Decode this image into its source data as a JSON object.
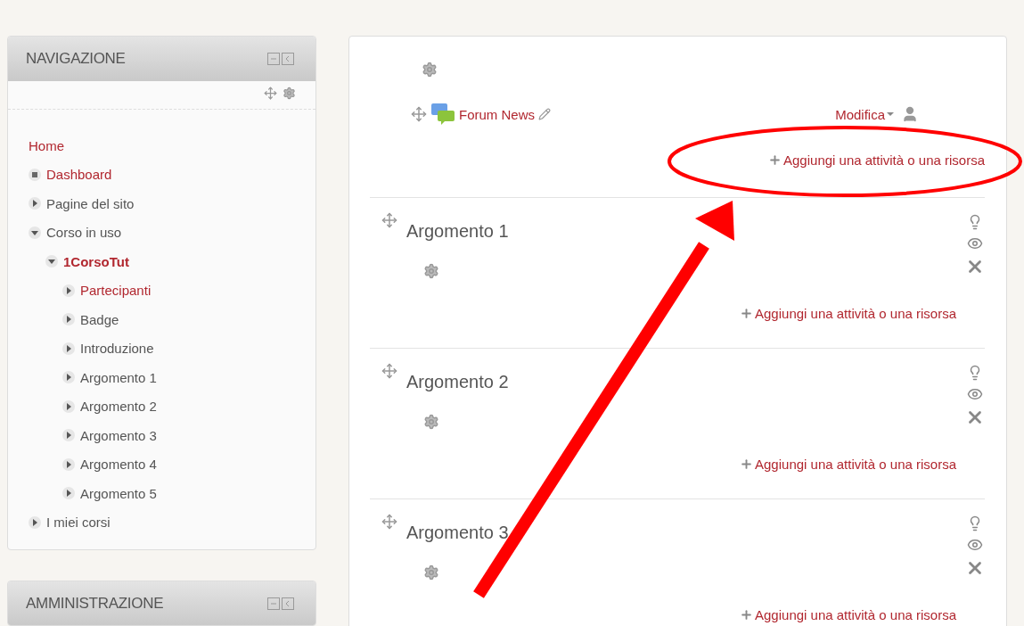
{
  "navigation": {
    "title": "NAVIGAZIONE",
    "items": [
      {
        "label": "Home",
        "kind": "plain",
        "link": true,
        "current": false
      },
      {
        "label": "Dashboard",
        "kind": "leaf",
        "link": true,
        "current": false
      },
      {
        "label": "Pagine del sito",
        "kind": "branch",
        "expanded": false,
        "link": false,
        "current": false
      },
      {
        "label": "Corso in uso",
        "kind": "branch",
        "expanded": true,
        "link": false,
        "current": false,
        "children": [
          {
            "label": "1CorsoTut",
            "kind": "branch",
            "expanded": true,
            "link": true,
            "current": true,
            "children": [
              {
                "label": "Partecipanti",
                "kind": "branch",
                "expanded": false,
                "link": true,
                "current": false
              },
              {
                "label": "Badge",
                "kind": "branch",
                "expanded": false,
                "link": false,
                "current": false
              },
              {
                "label": "Introduzione",
                "kind": "branch",
                "expanded": false,
                "link": false,
                "current": false
              },
              {
                "label": "Argomento 1",
                "kind": "branch",
                "expanded": false,
                "link": false,
                "current": false
              },
              {
                "label": "Argomento 2",
                "kind": "branch",
                "expanded": false,
                "link": false,
                "current": false
              },
              {
                "label": "Argomento 3",
                "kind": "branch",
                "expanded": false,
                "link": false,
                "current": false
              },
              {
                "label": "Argomento 4",
                "kind": "branch",
                "expanded": false,
                "link": false,
                "current": false
              },
              {
                "label": "Argomento 5",
                "kind": "branch",
                "expanded": false,
                "link": false,
                "current": false
              }
            ]
          }
        ]
      },
      {
        "label": "I miei corsi",
        "kind": "branch",
        "expanded": false,
        "link": false,
        "current": false
      }
    ]
  },
  "administration": {
    "title": "AMMINISTRAZIONE"
  },
  "sections": [
    {
      "kind": "general",
      "activity": {
        "name": "Forum News",
        "edit_menu": "Modifica"
      },
      "add_link": "Aggiungi una attività o una risorsa"
    },
    {
      "kind": "topic",
      "title": "Argomento 1",
      "add_link": "Aggiungi una attività o una risorsa"
    },
    {
      "kind": "topic",
      "title": "Argomento 2",
      "add_link": "Aggiungi una attività o una risorsa"
    },
    {
      "kind": "topic",
      "title": "Argomento 3",
      "add_link": "Aggiungi una attività o una risorsa"
    }
  ]
}
